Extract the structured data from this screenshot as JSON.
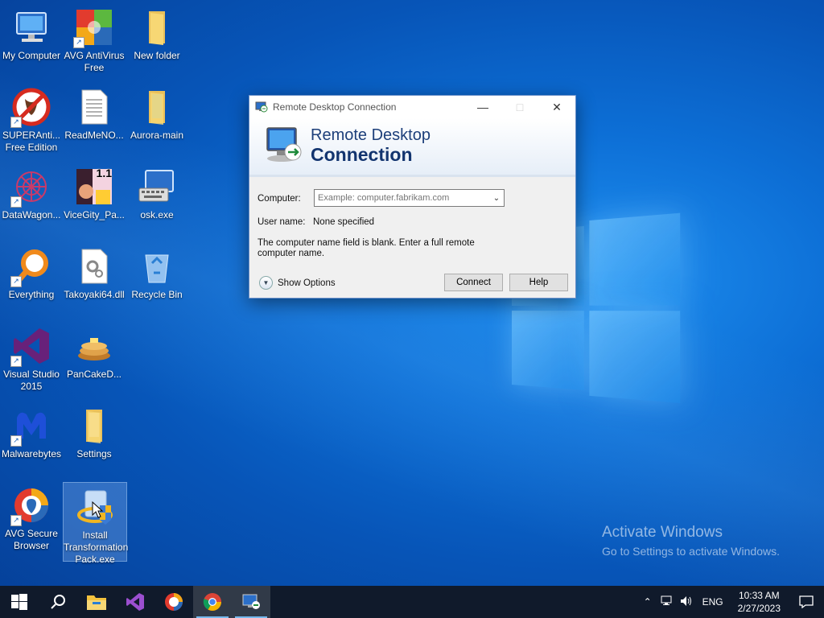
{
  "desktop": {
    "icons": [
      {
        "label": "My Computer"
      },
      {
        "label": "AVG AntiVirus Free"
      },
      {
        "label": "New folder"
      },
      {
        "label": "SUPERAnti... Free Edition"
      },
      {
        "label": "ReadMeNO..."
      },
      {
        "label": "Aurora-main"
      },
      {
        "label": "DataWagon..."
      },
      {
        "label": "ViceGity_Pa..."
      },
      {
        "label": "osk.exe"
      },
      {
        "label": "Everything"
      },
      {
        "label": "Takoyaki64.dll"
      },
      {
        "label": "Recycle Bin"
      },
      {
        "label": "Visual Studio 2015"
      },
      {
        "label": "PanCakeD..."
      },
      {
        "label": "Malwarebytes"
      },
      {
        "label": "Settings"
      },
      {
        "label": "AVG Secure Browser"
      },
      {
        "label": "Install Transformation Pack.exe"
      }
    ],
    "vicecity_badge": "1.1"
  },
  "rdc": {
    "title": "Remote Desktop Connection",
    "banner_line1": "Remote Desktop",
    "banner_line2": "Connection",
    "computer_label": "Computer:",
    "computer_placeholder": "Example: computer.fabrikam.com",
    "computer_value": "",
    "username_label": "User name:",
    "username_value": "None specified",
    "message": "The computer name field is blank. Enter a full remote computer name.",
    "show_options": "Show Options",
    "connect": "Connect",
    "help": "Help"
  },
  "watermark": {
    "line1": "Activate Windows",
    "line2": "Go to Settings to activate Windows."
  },
  "taskbar": {
    "language": "ENG",
    "time": "10:33 AM",
    "date": "2/27/2023",
    "pinned": [
      "start-icon",
      "search-icon",
      "file-explorer-icon",
      "visual-studio-icon",
      "avg-browser-icon",
      "chrome-icon",
      "remote-desktop-icon"
    ]
  },
  "colors": {
    "taskbar_bg": "#101a2b",
    "accent": "#76b9ed",
    "rdc_title_blue": "#12346f"
  }
}
